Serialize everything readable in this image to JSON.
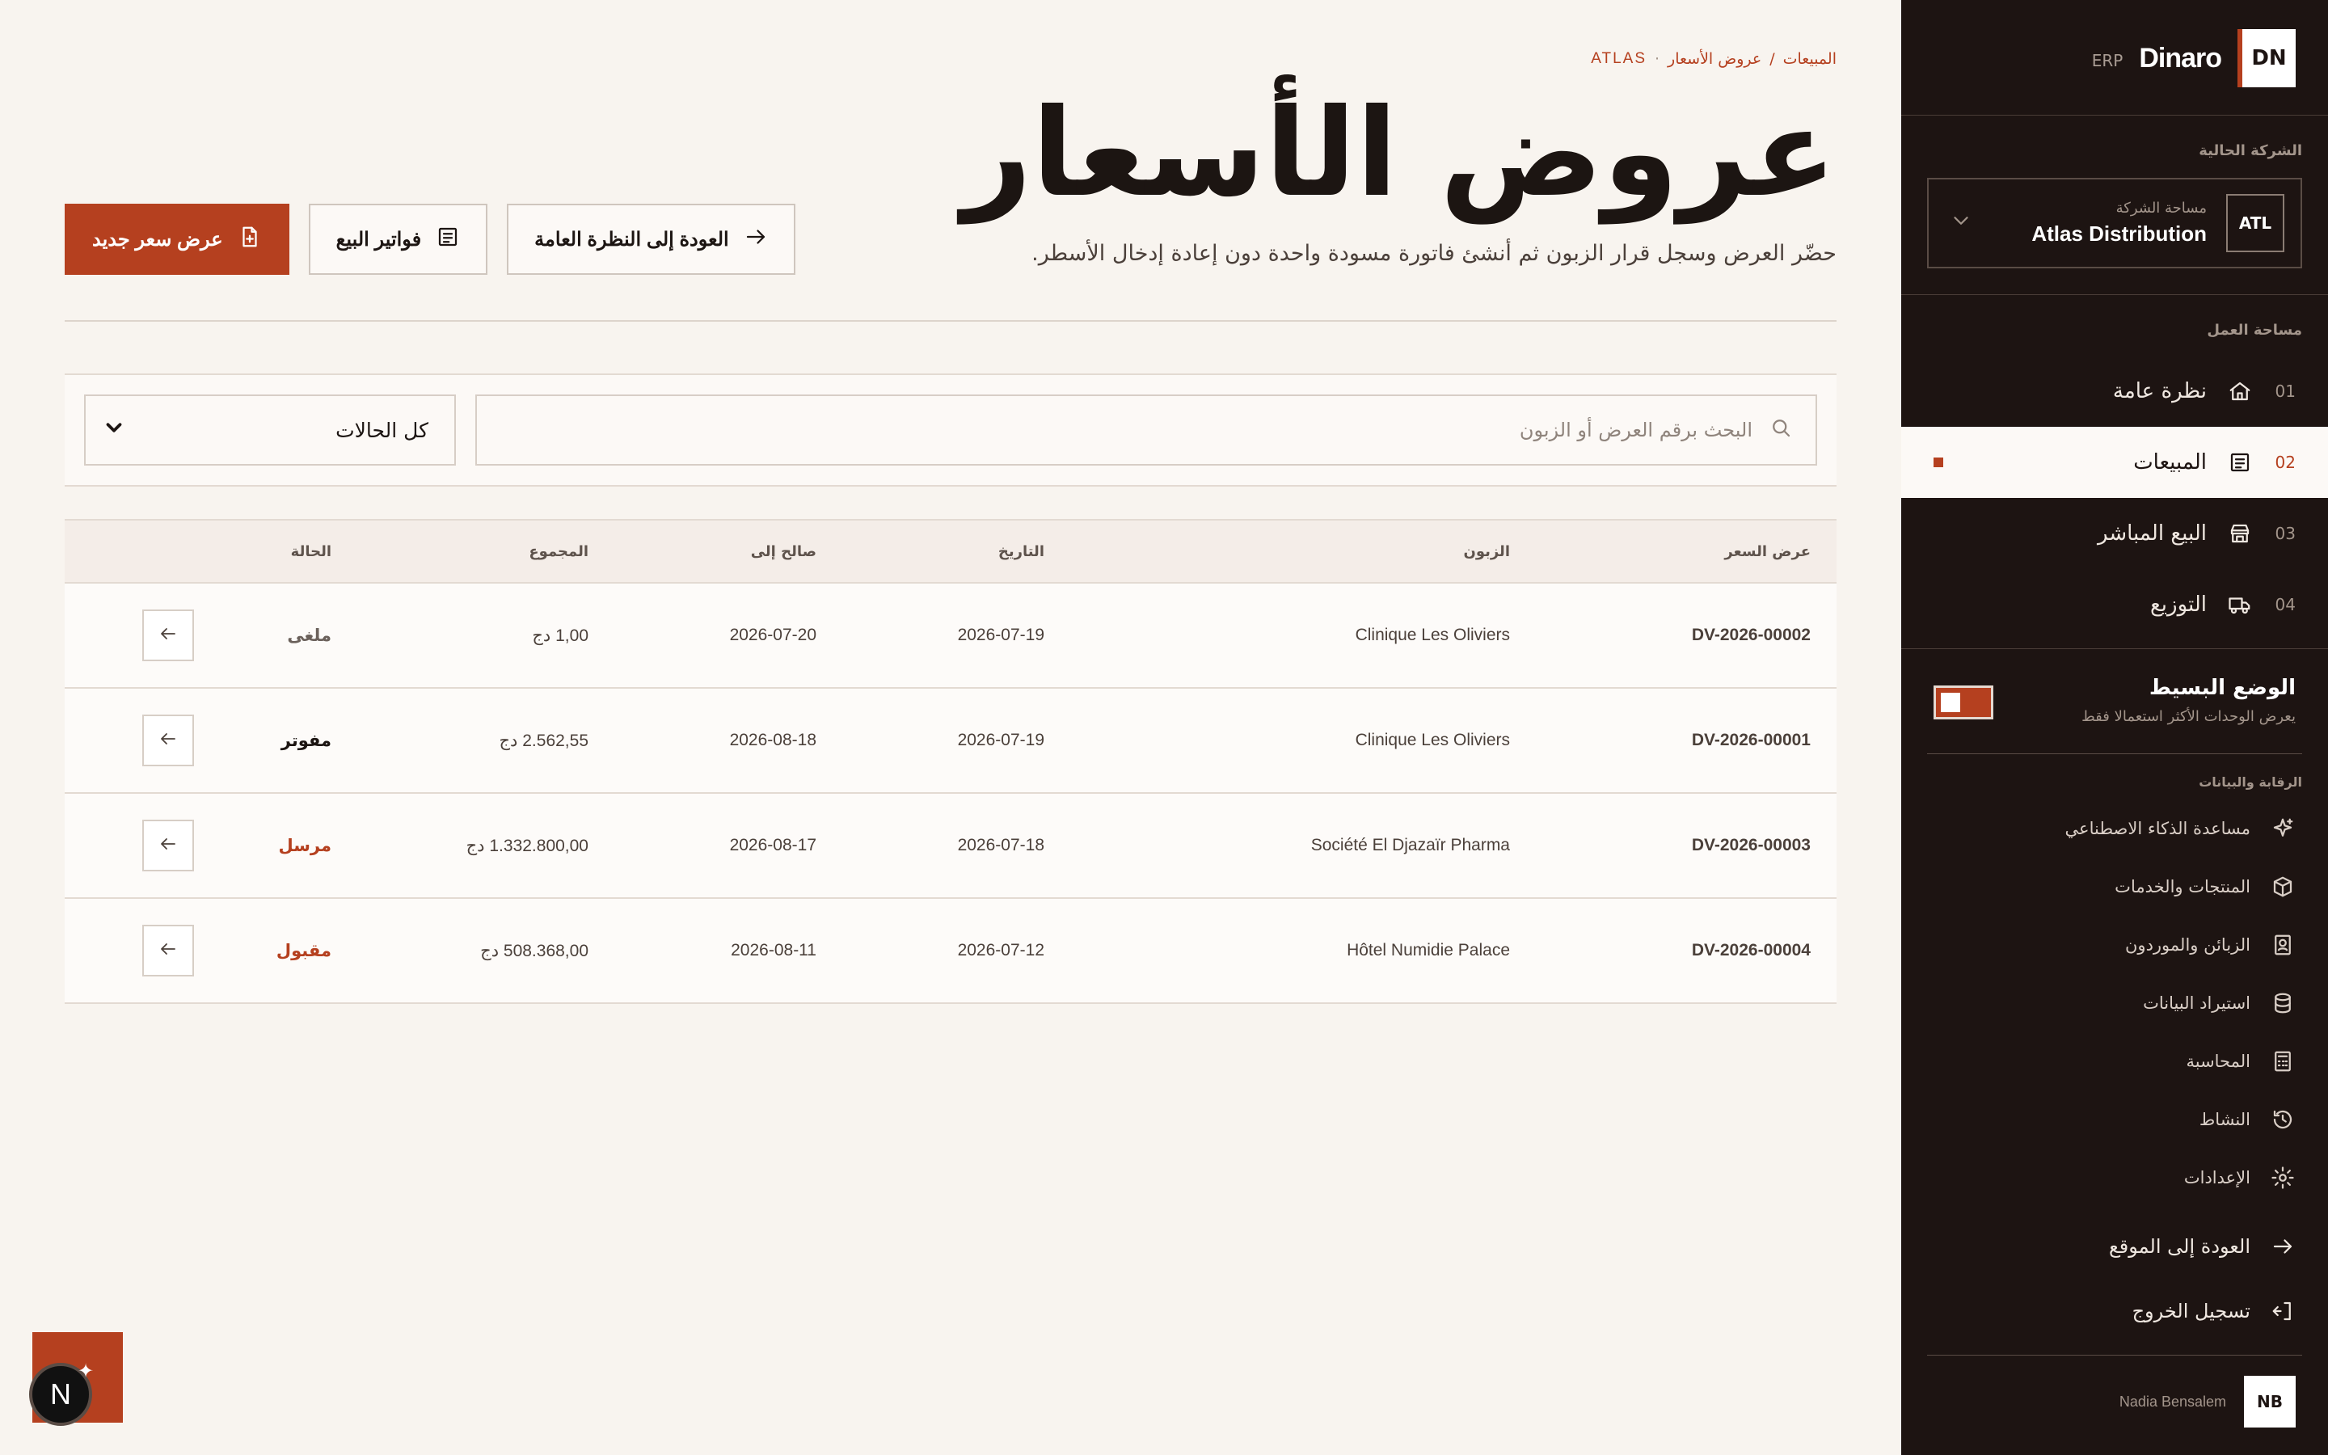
{
  "brand": {
    "logo": "DN",
    "name": "Dinaro",
    "suffix": "ERP"
  },
  "company": {
    "section_label": "الشركة الحالية",
    "badge": "ATL",
    "small": "مساحة الشركة",
    "name": "Atlas Distribution"
  },
  "workspace": {
    "label": "مساحة العمل",
    "items": [
      {
        "num": "01",
        "label": "نظرة عامة",
        "icon": "home-icon"
      },
      {
        "num": "02",
        "label": "المبيعات",
        "icon": "receipt-icon",
        "active": true
      },
      {
        "num": "03",
        "label": "البيع المباشر",
        "icon": "store-icon"
      },
      {
        "num": "04",
        "label": "التوزيع",
        "icon": "truck-icon"
      }
    ]
  },
  "simple_mode": {
    "title": "الوضع البسيط",
    "subtitle": "يعرض الوحدات الأكثر استعمالا فقط",
    "enabled": true
  },
  "control": {
    "label": "الرقابة والبيانات",
    "items": [
      {
        "label": "مساعدة الذكاء الاصطناعي",
        "icon": "sparkle-icon"
      },
      {
        "label": "المنتجات والخدمات",
        "icon": "box-icon"
      },
      {
        "label": "الزبائن والموردون",
        "icon": "contacts-icon"
      },
      {
        "label": "استيراد البيانات",
        "icon": "database-icon"
      },
      {
        "label": "المحاسبة",
        "icon": "calculator-icon"
      },
      {
        "label": "النشاط",
        "icon": "history-icon"
      },
      {
        "label": "الإعدادات",
        "icon": "settings-icon"
      }
    ]
  },
  "bottom": {
    "back_to_site": "العودة إلى الموقع",
    "logout": "تسجيل الخروج"
  },
  "user": {
    "initials": "NB",
    "name": "Nadia Bensalem"
  },
  "breadcrumb": {
    "root": "المبيعات",
    "sep": "/",
    "current": "عروض الأسعار",
    "dot": "·",
    "company": "ATLAS"
  },
  "page": {
    "title": "عروض الأسعار",
    "subtitle": "حضّر العرض وسجل قرار الزبون ثم أنشئ فاتورة مسودة واحدة دون إعادة إدخال الأسطر."
  },
  "actions": {
    "new_quote": "عرض سعر جديد",
    "sales_invoices": "فواتير البيع",
    "back_overview": "العودة إلى النظرة العامة"
  },
  "filters": {
    "search_placeholder": "البحث برقم العرض أو الزبون",
    "status_selected": "كل الحالات"
  },
  "table": {
    "headers": [
      "عرض السعر",
      "الزبون",
      "التاريخ",
      "صالح إلى",
      "المجموع",
      "الحالة"
    ],
    "rows": [
      {
        "quote": "DV-2026-00002",
        "client": "Clinique Les Oliviers",
        "date": "2026-07-19",
        "valid": "2026-07-20",
        "total": "1,00 دج",
        "status": "ملغى",
        "status_color": "#6b615b"
      },
      {
        "quote": "DV-2026-00001",
        "client": "Clinique Les Oliviers",
        "date": "2026-07-19",
        "valid": "2026-08-18",
        "total": "2.562,55 دج",
        "status": "مفوتر",
        "status_color": "#1c1512"
      },
      {
        "quote": "DV-2026-00003",
        "client": "Société El Djazaïr Pharma",
        "date": "2026-07-18",
        "valid": "2026-08-17",
        "total": "1.332.800,00 دج",
        "status": "مرسل",
        "status_color": "#b5401f"
      },
      {
        "quote": "DV-2026-00004",
        "client": "Hôtel Numidie Palace",
        "date": "2026-07-12",
        "valid": "2026-08-11",
        "total": "508.368,00 دج",
        "status": "مقبول",
        "status_color": "#b5401f"
      }
    ]
  },
  "fab": {
    "letter": "N"
  },
  "colors": {
    "accent": "#b5401f",
    "sidebar_bg": "#1d1412",
    "page_bg": "#f8f4ef"
  }
}
